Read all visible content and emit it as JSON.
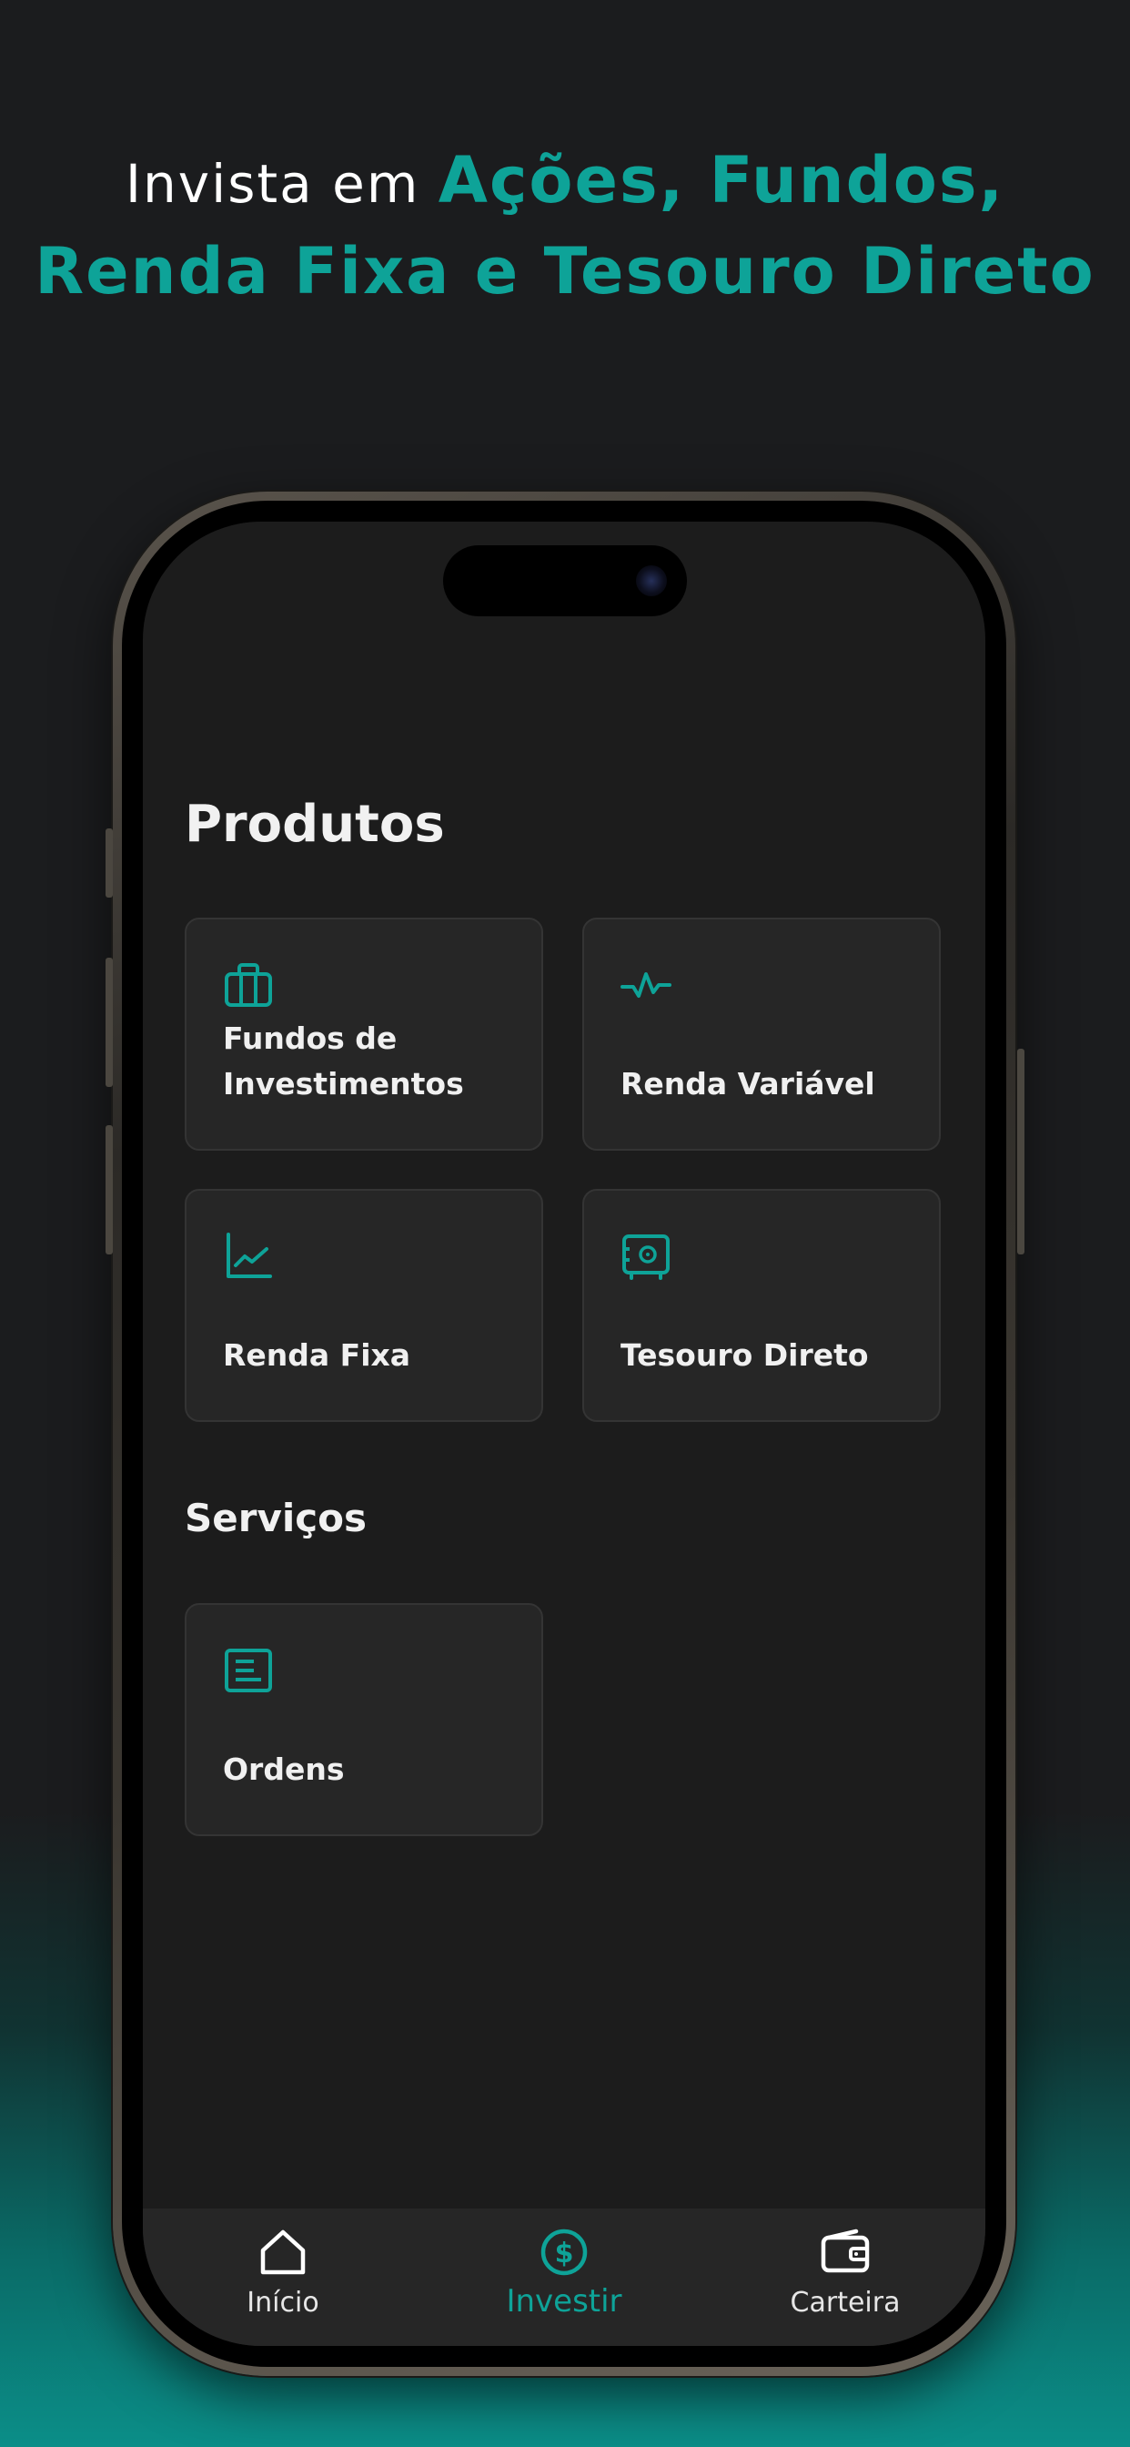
{
  "headline": {
    "part1": "Invista em ",
    "part2": "Ações, Fundos,",
    "part3": "Renda Fixa e Tesouro Direto"
  },
  "colors": {
    "accent": "#0ea398",
    "background": "#1b1c1e",
    "card": "#262626",
    "text": "#f0f0f0"
  },
  "products": {
    "title": "Produtos",
    "items": [
      {
        "label": "Fundos de Investimentos",
        "icon": "briefcase-icon"
      },
      {
        "label": "Renda Variável",
        "icon": "pulse-icon"
      },
      {
        "label": "Renda Fixa",
        "icon": "chart-line-icon"
      },
      {
        "label": "Tesouro Direto",
        "icon": "safe-icon"
      }
    ]
  },
  "services": {
    "title": "Serviços",
    "items": [
      {
        "label": "Ordens",
        "icon": "document-icon"
      }
    ]
  },
  "tabbar": {
    "items": [
      {
        "label": "Início",
        "icon": "home-icon",
        "active": false
      },
      {
        "label": "Investir",
        "icon": "dollar-circle-icon",
        "active": true
      },
      {
        "label": "Carteira",
        "icon": "wallet-icon",
        "active": false
      }
    ]
  }
}
